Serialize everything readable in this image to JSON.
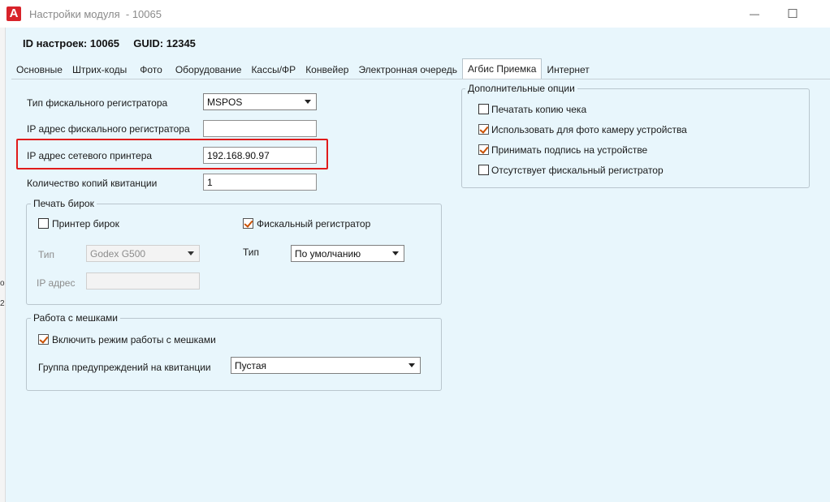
{
  "window": {
    "logo_letter": "A",
    "title": "Настройки модуля  - 10065",
    "minimize_glyph": "—",
    "maximize_glyph": "☐"
  },
  "left_strip_marks": [
    "о",
    "2"
  ],
  "header": {
    "id_label": "ID настроек:",
    "id_value": "10065",
    "guid_label": "GUID:",
    "guid_value": "12345"
  },
  "tabs": [
    {
      "label": "Основные"
    },
    {
      "label": "Штрих-коды"
    },
    {
      "label": "Фото"
    },
    {
      "label": "Оборудование"
    },
    {
      "label": "Кассы/ФР"
    },
    {
      "label": "Конвейер"
    },
    {
      "label": "Электронная очередь"
    },
    {
      "label": "Агбис Приемка",
      "active": true
    },
    {
      "label": "Интернет"
    }
  ],
  "form": {
    "fiscal_type_label": "Тип фискального регистратора",
    "fiscal_type_value": "MSPOS",
    "fiscal_ip_label": "IP адрес фискального регистратора",
    "fiscal_ip_value": "",
    "printer_ip_label": "IP адрес сетевого принтера",
    "printer_ip_value": "192.168.90.97",
    "copies_label": "Количество копий квитанции",
    "copies_value": "1"
  },
  "tag_printing": {
    "title": "Печать бирок",
    "tag_printer_label": "Принтер бирок",
    "tag_printer_checked": false,
    "fiscal_checkbox_label": "Фискальный регистратор",
    "fiscal_checkbox_checked": true,
    "type_label_left": "Тип",
    "type_value_left": "Godex G500",
    "ip_label": "IP адрес",
    "ip_value": "",
    "type_label_right": "Тип",
    "type_value_right": "По умолчанию"
  },
  "bags": {
    "title": "Работа с мешками",
    "enable_label": "Включить режим работы с мешками",
    "enable_checked": true,
    "warning_group_label": "Группа предупреждений на квитанции",
    "warning_group_value": "Пустая"
  },
  "extra_options": {
    "title": "Дополнительные опции",
    "items": [
      {
        "label": "Печатать копию чека",
        "checked": false
      },
      {
        "label": "Использовать для фото камеру устройства",
        "checked": true
      },
      {
        "label": "Принимать подпись на устройстве",
        "checked": true
      },
      {
        "label": "Отсутствует фискальный регистратор",
        "checked": false
      }
    ]
  },
  "colors": {
    "background": "#e8f6fc",
    "highlight_border": "#e01b1b",
    "checkmark": "#c85000",
    "logo": "#d8232a"
  }
}
